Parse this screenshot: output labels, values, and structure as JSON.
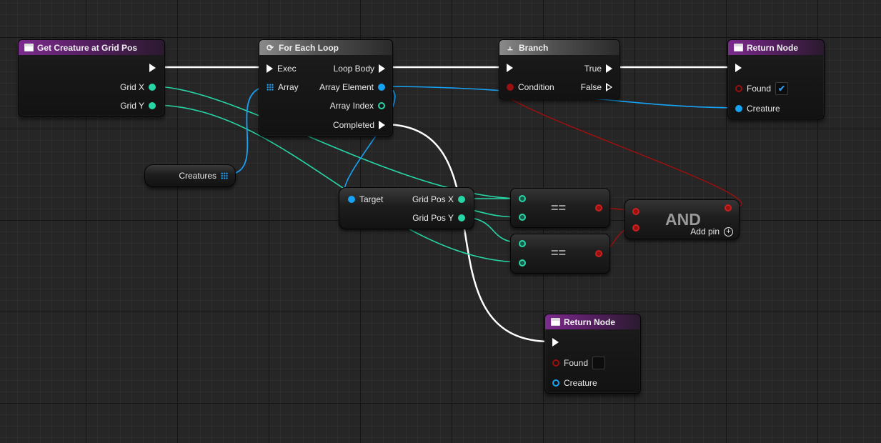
{
  "nodes": {
    "get_creature": {
      "title": "Get Creature at Grid Pos",
      "pins": {
        "grid_x": "Grid X",
        "grid_y": "Grid Y"
      }
    },
    "for_each": {
      "title": "For Each Loop",
      "pins": {
        "exec": "Exec",
        "array": "Array",
        "loop_body": "Loop Body",
        "array_element": "Array Element",
        "array_index": "Array Index",
        "completed": "Completed"
      }
    },
    "branch": {
      "title": "Branch",
      "pins": {
        "condition": "Condition",
        "true": "True",
        "false": "False"
      }
    },
    "return_top": {
      "title": "Return Node",
      "pins": {
        "found": "Found",
        "creature": "Creature"
      },
      "found_checked": true
    },
    "creatures_var": {
      "label": "Creatures"
    },
    "break_struct": {
      "pins": {
        "target": "Target",
        "grid_pos_x": "Grid Pos X",
        "grid_pos_y": "Grid Pos Y"
      }
    },
    "equal_1": {
      "op": "=="
    },
    "equal_2": {
      "op": "=="
    },
    "and_node": {
      "op": "AND",
      "add_pin": "Add pin"
    },
    "return_bottom": {
      "title": "Return Node",
      "pins": {
        "found": "Found",
        "creature": "Creature"
      },
      "found_checked": false
    }
  },
  "colors": {
    "exec_wire": "#ffffff",
    "int_wire": "#27d6a6",
    "object_wire": "#17a3f5",
    "bool_wire": "#9a0f0f",
    "function_header": "#7c2c8d",
    "flow_header": "#8a8a8a"
  },
  "icons": {
    "function": "function-icon",
    "loop": "loop-icon",
    "branch": "branch-icon",
    "array": "array-grid-icon",
    "add": "add-pin-icon",
    "check": "checkmark-icon"
  }
}
